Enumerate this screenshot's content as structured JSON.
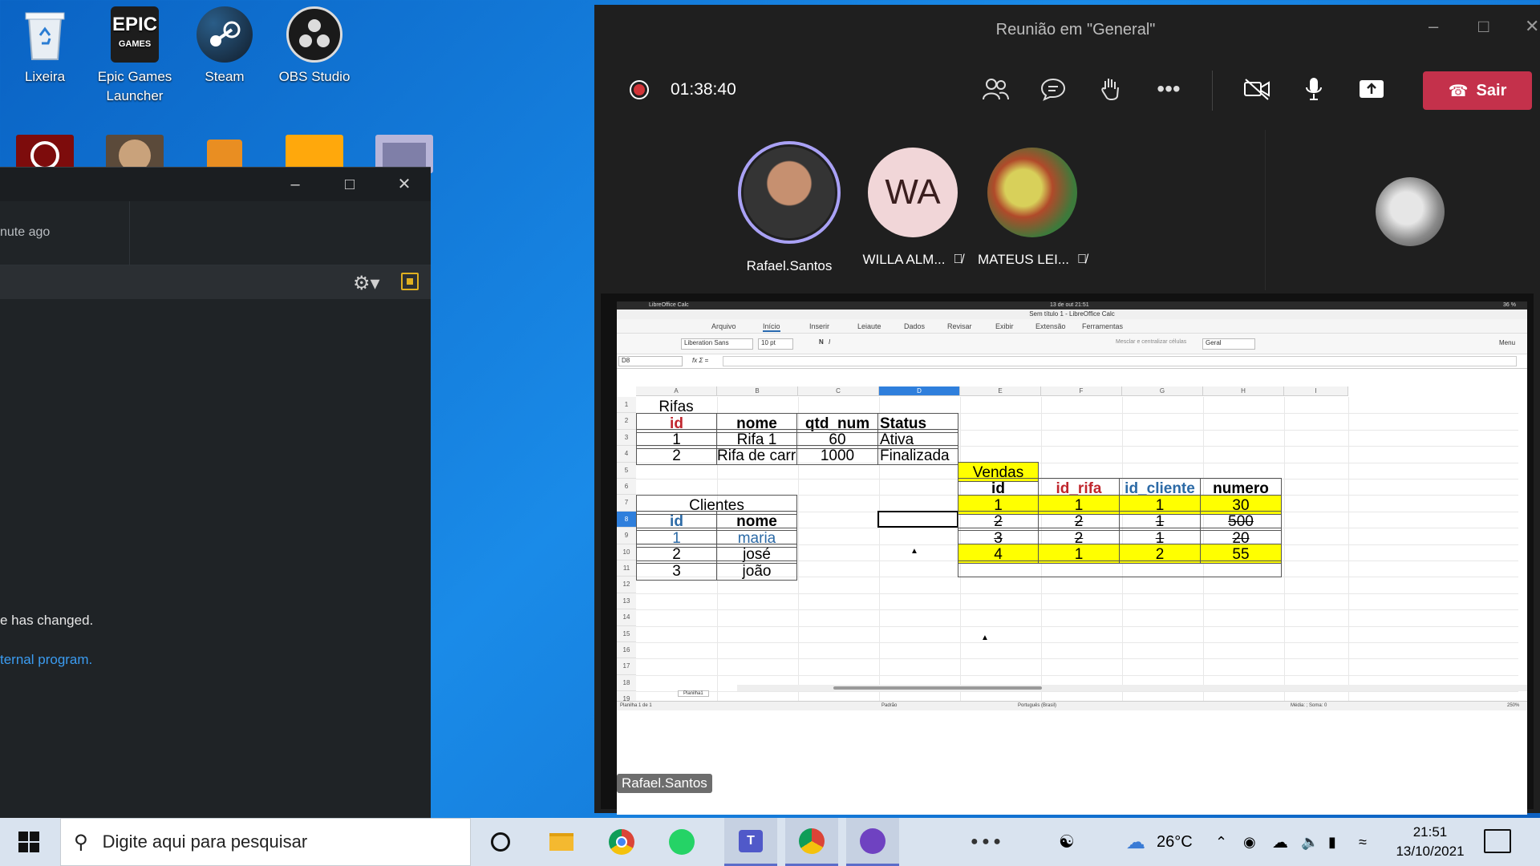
{
  "desktop": {
    "icons": [
      {
        "label": "Lixeira"
      },
      {
        "label": "Epic Games Launcher"
      },
      {
        "label": "Steam"
      },
      {
        "label": "OBS Studio"
      }
    ],
    "epic_logo_text": "EPIC",
    "epic_logo_sub": "GAMES"
  },
  "darkwin": {
    "time_text": "nute ago",
    "message_line1": "e has changed.",
    "message_link": "ternal program."
  },
  "teams": {
    "title": "Reunião em \"General\"",
    "timer": "01:38:40",
    "leave_label": "Sair",
    "participants": [
      {
        "name": "Rafael.Santos",
        "initials": ""
      },
      {
        "name": "WILLA ALM...",
        "initials": "WA"
      },
      {
        "name": "MATEUS LEI...",
        "initials": ""
      }
    ],
    "presenter_label": "Rafael.Santos"
  },
  "calc": {
    "system_app": "LibreOffice Calc",
    "system_clock": "13 de out 21:51",
    "system_battery": "36 %",
    "window_title": "Sem título 1 - LibreOffice Calc",
    "menus": [
      "Arquivo",
      "Início",
      "Inserir",
      "Leiaute",
      "Dados",
      "Revisar",
      "Exibir",
      "Extensão",
      "Ferramentas"
    ],
    "font_name": "Liberation Sans",
    "font_size": "10 pt",
    "number_format": "Geral",
    "merge_label": "Mesclar e centralizar células",
    "menu_label": "Menu",
    "name_box": "D8",
    "columns": [
      "A",
      "B",
      "C",
      "D",
      "E",
      "F",
      "G",
      "H",
      "I"
    ],
    "rows": [
      "1",
      "2",
      "3",
      "4",
      "5",
      "6",
      "7",
      "8",
      "9",
      "10",
      "11",
      "12",
      "13",
      "14",
      "15",
      "16",
      "17",
      "18",
      "19"
    ],
    "rifas": {
      "title": "Rifas",
      "headers": [
        "id",
        "nome",
        "qtd_num",
        "Status"
      ],
      "rows": [
        [
          "1",
          "Rifa 1",
          "60",
          "Ativa"
        ],
        [
          "2",
          "Rifa de carro",
          "1000",
          "Finalizada"
        ]
      ]
    },
    "clientes": {
      "title": "Clientes",
      "headers": [
        "id",
        "nome"
      ],
      "rows": [
        [
          "1",
          "maria"
        ],
        [
          "2",
          "josé"
        ],
        [
          "3",
          "joão"
        ]
      ]
    },
    "vendas": {
      "title": "Vendas",
      "headers": [
        "id",
        "id_rifa",
        "id_cliente",
        "numero"
      ],
      "rows": [
        [
          "1",
          "1",
          "1",
          "30"
        ],
        [
          "2",
          "2",
          "1",
          "500"
        ],
        [
          "3",
          "2",
          "1",
          "20"
        ],
        [
          "4",
          "1",
          "2",
          "55"
        ]
      ]
    },
    "status_sheet": "Planilha 1 de 1",
    "status_style": "Padrão",
    "status_lang": "Português (Brasil)",
    "status_sum": "Média: ; Soma: 0",
    "status_zoom": "250%",
    "sheet_tab": "Planilha1"
  },
  "taskbar": {
    "search_placeholder": "Digite aqui para pesquisar",
    "temperature": "26°C",
    "clock_time": "21:51",
    "clock_date": "13/10/2021"
  },
  "colors": {
    "teams_leave": "#c4314b",
    "highlight": "#ffff00",
    "red_text": "#c0262d",
    "blue_text": "#2c6aa6"
  }
}
